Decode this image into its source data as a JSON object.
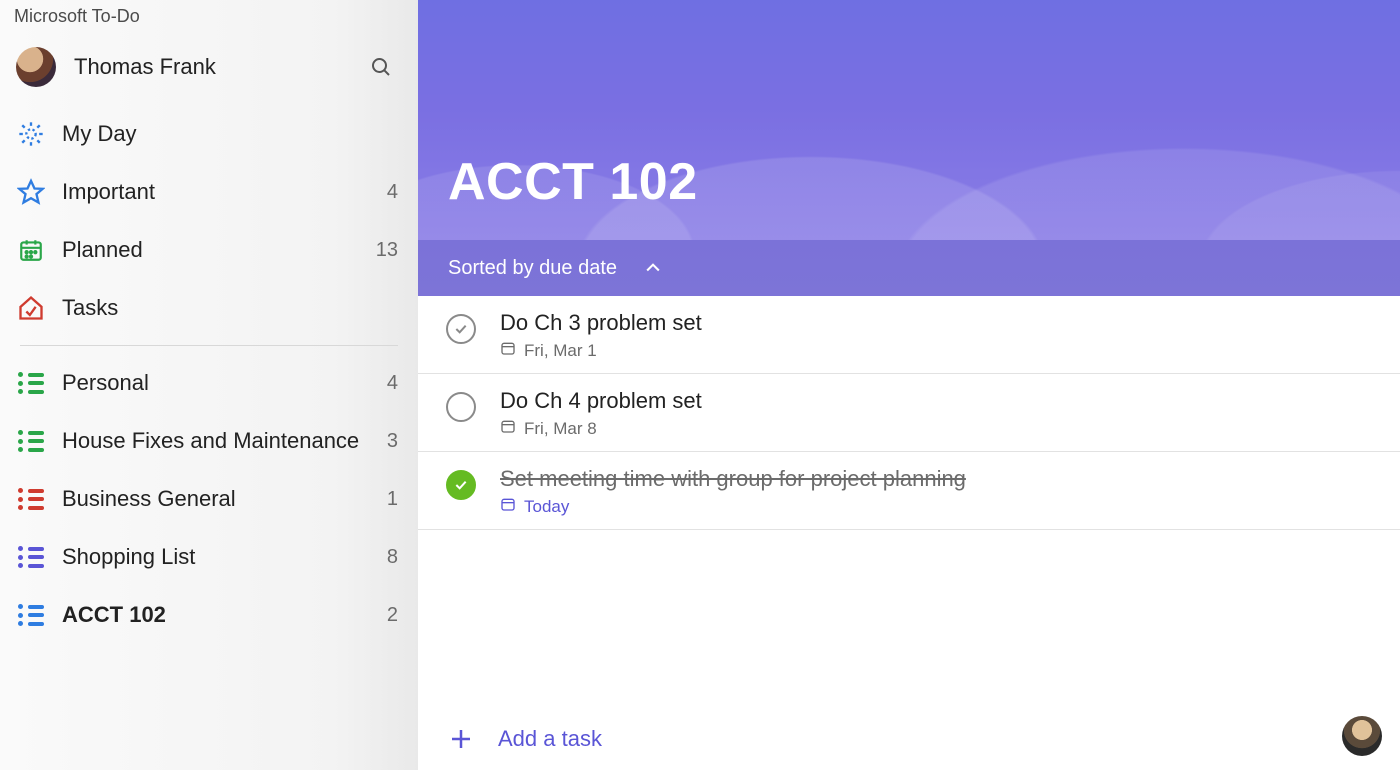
{
  "app_title": "Microsoft To-Do",
  "user": {
    "name": "Thomas Frank"
  },
  "smart_lists": [
    {
      "key": "myday",
      "label": "My Day",
      "count": "",
      "icon": "sun",
      "color": "#2f7de1"
    },
    {
      "key": "important",
      "label": "Important",
      "count": "4",
      "icon": "star",
      "color": "#2f7de1"
    },
    {
      "key": "planned",
      "label": "Planned",
      "count": "13",
      "icon": "calendar",
      "color": "#2aa649"
    },
    {
      "key": "tasks",
      "label": "Tasks",
      "count": "",
      "icon": "home",
      "color": "#cf3b2f"
    }
  ],
  "custom_lists": [
    {
      "key": "personal",
      "label": "Personal",
      "count": "4",
      "color": "#2aa649"
    },
    {
      "key": "house",
      "label": "House Fixes and Maintenance",
      "count": "3",
      "color": "#2aa649"
    },
    {
      "key": "bizgen",
      "label": "Business General",
      "count": "1",
      "color": "#cf3b2f"
    },
    {
      "key": "shopping",
      "label": "Shopping List",
      "count": "8",
      "color": "#5a55d6"
    },
    {
      "key": "acct102",
      "label": "ACCT 102",
      "count": "2",
      "color": "#2f7de1",
      "active": true
    }
  ],
  "main": {
    "title": "ACCT 102",
    "sort_label": "Sorted by due date",
    "add_label": "Add a task"
  },
  "tasks": [
    {
      "title": "Do Ch 3 problem set",
      "due": "Fri, Mar 1",
      "completed": false,
      "hover": true,
      "today": false
    },
    {
      "title": "Do Ch 4 problem set",
      "due": "Fri, Mar 8",
      "completed": false,
      "hover": false,
      "today": false
    },
    {
      "title": "Set meeting time with group for project planning",
      "due": "Today",
      "completed": true,
      "hover": false,
      "today": true
    }
  ]
}
